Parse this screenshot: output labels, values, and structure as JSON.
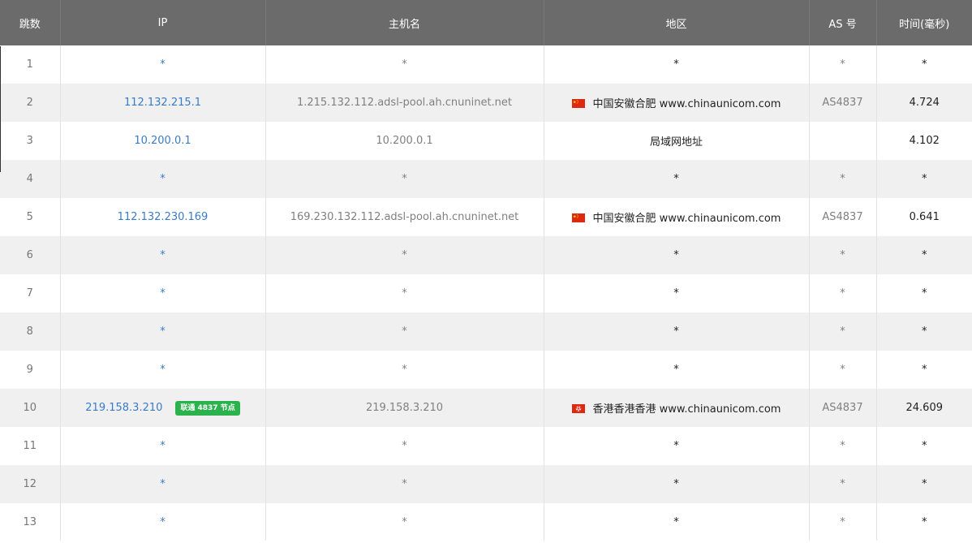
{
  "header": {
    "hop": "跳数",
    "ip": "IP",
    "hostname": "主机名",
    "region": "地区",
    "as": "AS 号",
    "time": "时间(毫秒)"
  },
  "rows": [
    {
      "hop": "1",
      "ip": "*",
      "hostname": "*",
      "region": "*",
      "as": "*",
      "time": "*"
    },
    {
      "hop": "2",
      "ip": "112.132.215.1",
      "hostname": "1.215.132.112.adsl-pool.ah.cnuninet.net",
      "flag": "cn-flag",
      "region": "中国安徽合肥 www.chinaunicom.com",
      "as": "AS4837",
      "time": "4.724"
    },
    {
      "hop": "3",
      "ip": "10.200.0.1",
      "hostname": "10.200.0.1",
      "region": "局域网地址",
      "as": "",
      "time": "4.102"
    },
    {
      "hop": "4",
      "ip": "*",
      "hostname": "*",
      "region": "*",
      "as": "*",
      "time": "*"
    },
    {
      "hop": "5",
      "ip": "112.132.230.169",
      "hostname": "169.230.132.112.adsl-pool.ah.cnuninet.net",
      "flag": "cn-flag",
      "region": "中国安徽合肥 www.chinaunicom.com",
      "as": "AS4837",
      "time": "0.641"
    },
    {
      "hop": "6",
      "ip": "*",
      "hostname": "*",
      "region": "*",
      "as": "*",
      "time": "*"
    },
    {
      "hop": "7",
      "ip": "*",
      "hostname": "*",
      "region": "*",
      "as": "*",
      "time": "*"
    },
    {
      "hop": "8",
      "ip": "*",
      "hostname": "*",
      "region": "*",
      "as": "*",
      "time": "*"
    },
    {
      "hop": "9",
      "ip": "*",
      "hostname": "*",
      "region": "*",
      "as": "*",
      "time": "*"
    },
    {
      "hop": "10",
      "ip": "219.158.3.210",
      "badge": "联通 4837 节点",
      "hostname": "219.158.3.210",
      "flag": "hk-flag",
      "region": "香港香港香港 www.chinaunicom.com",
      "as": "AS4837",
      "time": "24.609"
    },
    {
      "hop": "11",
      "ip": "*",
      "hostname": "*",
      "region": "*",
      "as": "*",
      "time": "*"
    },
    {
      "hop": "12",
      "ip": "*",
      "hostname": "*",
      "region": "*",
      "as": "*",
      "time": "*"
    },
    {
      "hop": "13",
      "ip": "*",
      "hostname": "*",
      "region": "*",
      "as": "*",
      "time": "*"
    }
  ],
  "colors": {
    "header_bg": "#6b6b6b",
    "ip_link": "#3a7bc8",
    "badge_bg": "#2bb24c",
    "row_alt": "#f0f0f0"
  }
}
